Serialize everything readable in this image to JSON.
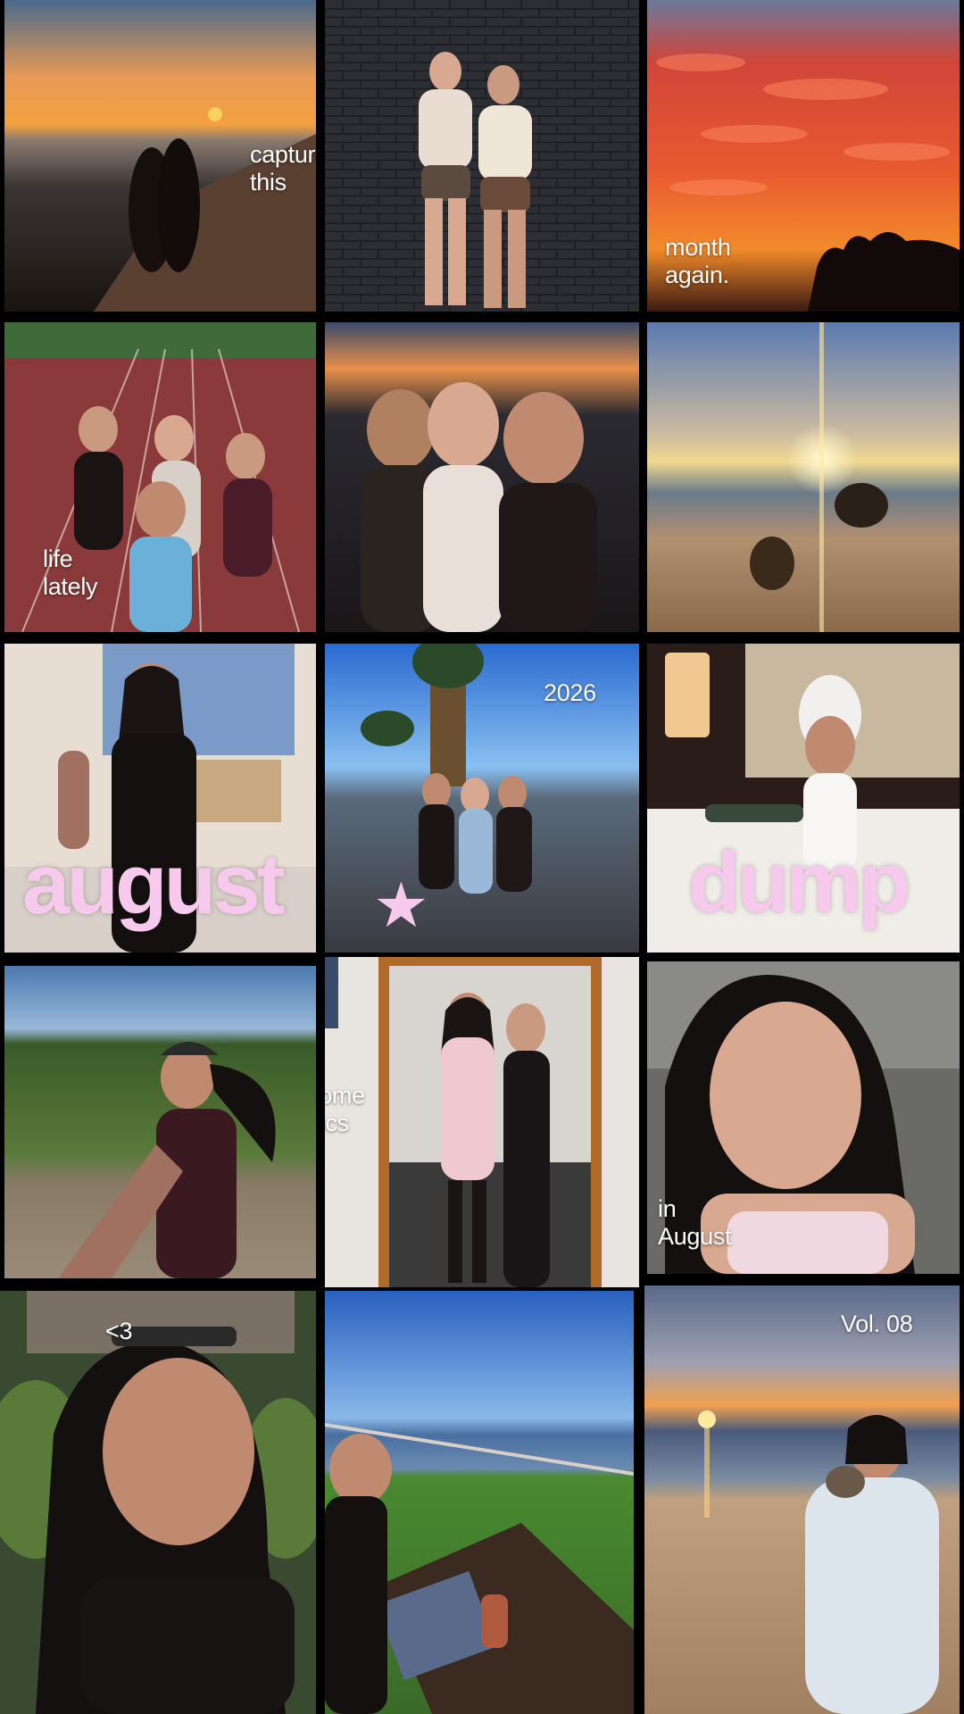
{
  "captions": {
    "capture": "capture\nthis",
    "month": "month\nagain.",
    "life": "life\nlately",
    "year": "2026",
    "some_pics": "some\npics",
    "in_august": "in\nAugust",
    "heart": "<3",
    "volume": "Vol. 08"
  },
  "title": {
    "left_word": "august",
    "right_word": "dump",
    "star": "★"
  },
  "colors": {
    "title_pink": "#f7c9ec",
    "background": "#000000"
  },
  "photos": [
    "sunset-beach-couple-photo",
    "brick-wall-friends-photo",
    "red-sunset-clouds-photo",
    "running-track-group-photo",
    "sunset-selfie-photo",
    "beach-sun-dogs-photo",
    "mirror-selfie-photo",
    "promenade-palm-friends-photo",
    "hotel-champagne-photo",
    "field-walk-selfie-photo",
    "mirror-outfit-photo",
    "smiling-selfie-photo",
    "garden-smile-selfie-photo",
    "laptop-seaside-photo",
    "beach-sunset-puppy-photo"
  ]
}
